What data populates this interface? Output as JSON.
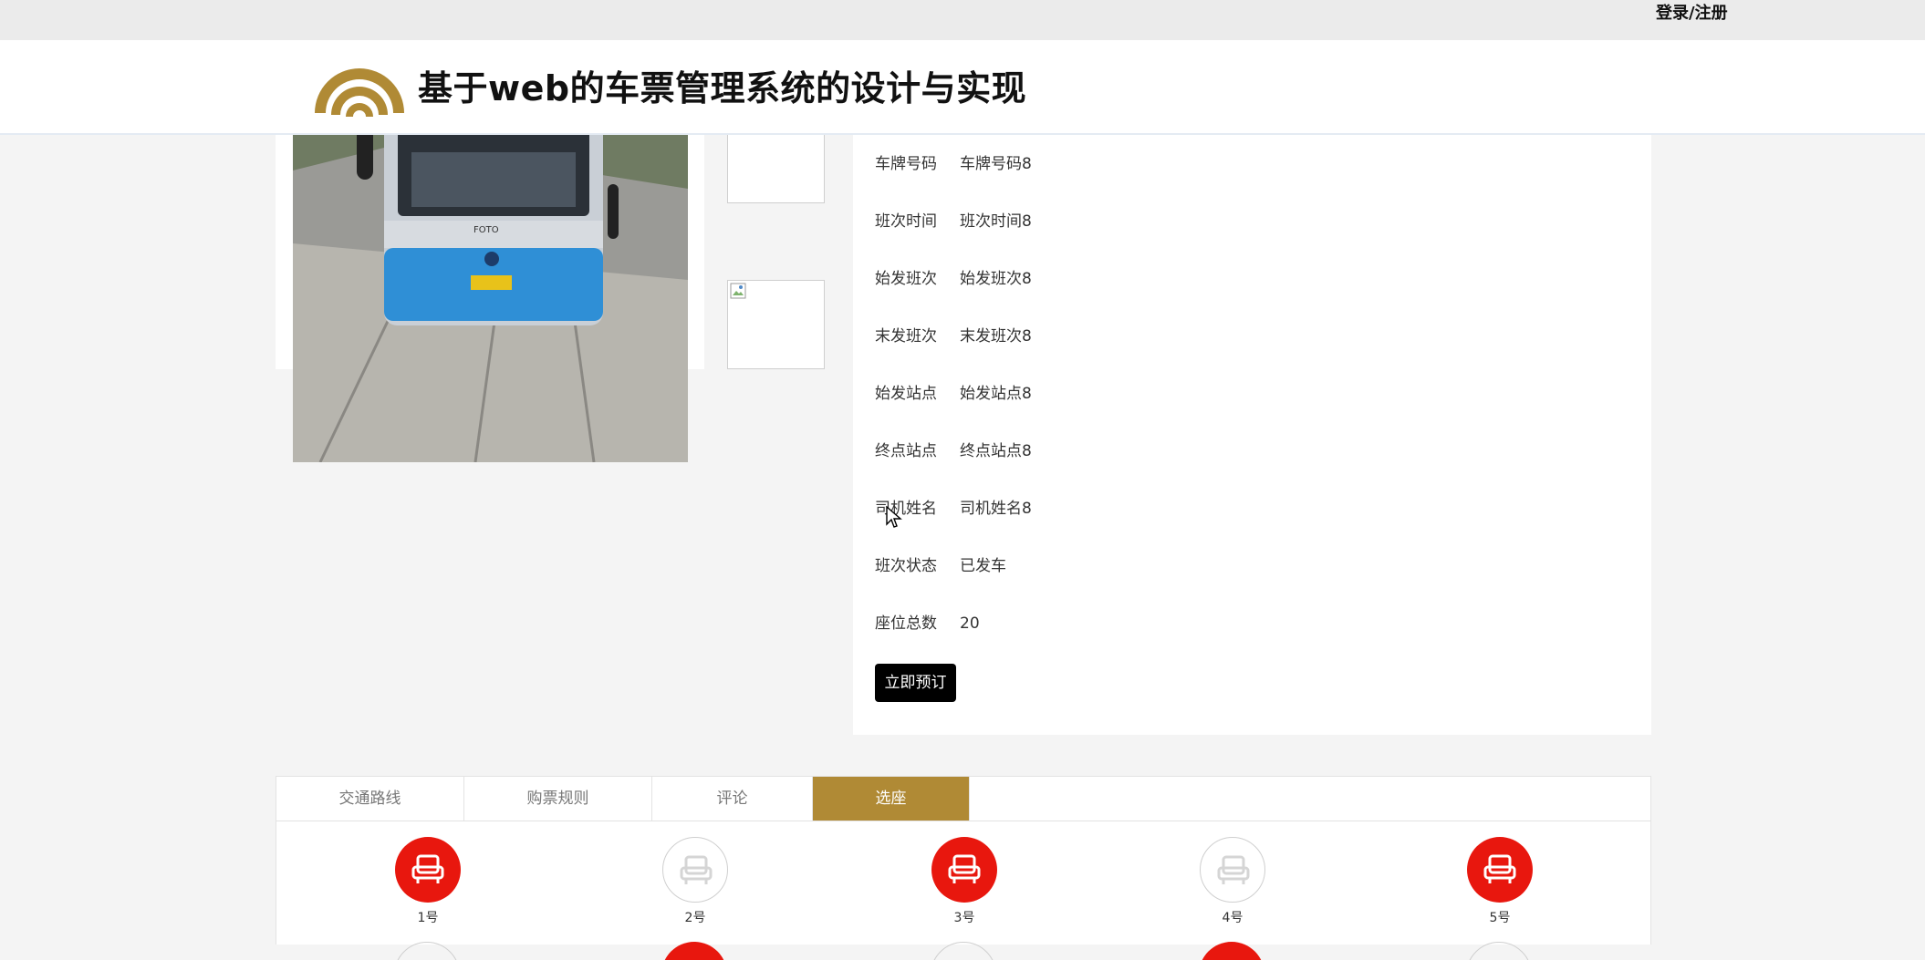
{
  "topbar": {
    "login_label": "登录/注册"
  },
  "header": {
    "title": "基于web的车票管理系统的设计与实现",
    "logo_color": "#b08a35"
  },
  "detail": {
    "rows": [
      {
        "label": "车牌号码",
        "value": "车牌号码8"
      },
      {
        "label": "班次时间",
        "value": "班次时间8"
      },
      {
        "label": "始发班次",
        "value": "始发班次8"
      },
      {
        "label": "末发班次",
        "value": "末发班次8"
      },
      {
        "label": "始发站点",
        "value": "始发站点8"
      },
      {
        "label": "终点站点",
        "value": "终点站点8"
      },
      {
        "label": "司机姓名",
        "value": "司机姓名8"
      },
      {
        "label": "班次状态",
        "value": "已发车"
      },
      {
        "label": "座位总数",
        "value": "20"
      }
    ],
    "book_button": "立即预订"
  },
  "tabs": [
    {
      "label": "交通路线",
      "active": false
    },
    {
      "label": "购票规则",
      "active": false
    },
    {
      "label": "评论",
      "active": false
    },
    {
      "label": "选座",
      "active": true
    }
  ],
  "seats": [
    {
      "label": "1号",
      "taken": true
    },
    {
      "label": "2号",
      "taken": false
    },
    {
      "label": "3号",
      "taken": true
    },
    {
      "label": "4号",
      "taken": false
    },
    {
      "label": "5号",
      "taken": true
    }
  ],
  "colors": {
    "accent": "#b08a35",
    "seat_taken": "#e8170e",
    "button": "#000000"
  }
}
